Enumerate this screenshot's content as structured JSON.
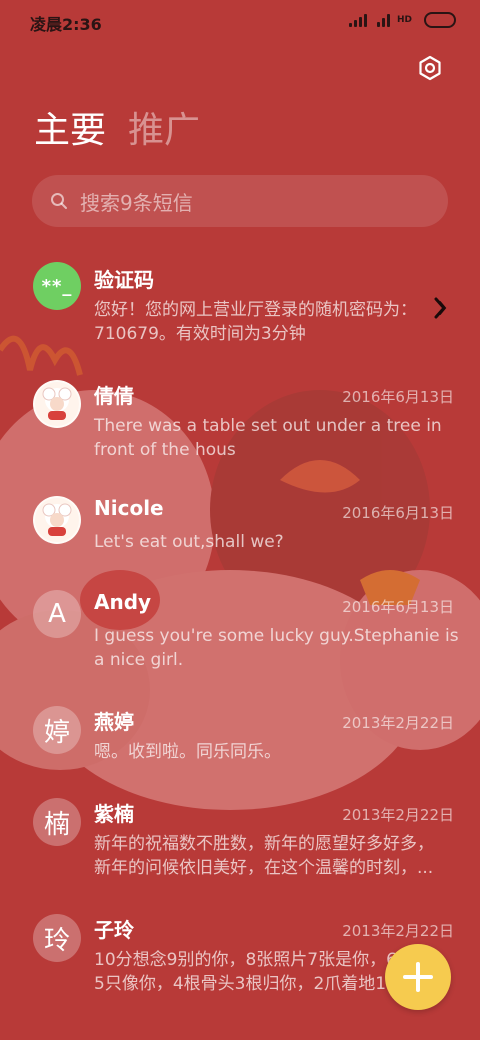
{
  "status_bar": {
    "time": "凌晨2:36",
    "network_label": "HD"
  },
  "tabs": [
    {
      "label": "主要",
      "active": true
    },
    {
      "label": "推广",
      "active": false
    }
  ],
  "search": {
    "placeholder": "搜索9条短信"
  },
  "icons": {
    "settings": "gear-icon",
    "search": "search-icon",
    "compose": "plus-icon",
    "verification_action": "chevron-right-icon"
  },
  "messages": [
    {
      "avatar_type": "badge",
      "avatar_text": "**_",
      "name": "验证码",
      "date": "",
      "preview": "您好！您的网上营业厅登录的随机密码为：710679。有效时间为3分钟"
    },
    {
      "avatar_type": "image",
      "avatar_text": "",
      "name": "倩倩",
      "date": "2016年6月13日",
      "preview": "There was a table set out under a tree in front of the hous"
    },
    {
      "avatar_type": "image",
      "avatar_text": "",
      "name": "Nicole",
      "date": "2016年6月13日",
      "preview": "Let's eat out,shall we?"
    },
    {
      "avatar_type": "letter",
      "avatar_text": "A",
      "name": "Andy",
      "date": "2016年6月13日",
      "preview": "I guess you're some lucky guy.Stephanie is a nice girl."
    },
    {
      "avatar_type": "letter",
      "avatar_text": "婷",
      "name": "燕婷",
      "date": "2013年2月22日",
      "preview": "嗯。收到啦。同乐同乐。"
    },
    {
      "avatar_type": "letter",
      "avatar_text": "楠",
      "name": "紫楠",
      "date": "2013年2月22日",
      "preview_lines": [
        "新年的祝福数不胜数，新年的愿望好多好多，",
        "新年的问候依旧美好，在这个温馨的时刻，..."
      ]
    },
    {
      "avatar_type": "letter",
      "avatar_text": "玲",
      "name": "子玲",
      "date": "2013年2月22日",
      "preview_lines": [
        "10分想念9别的你，8张照片7张是你，6",
        "5只像你，4根骨头3根归你，2爪着地1"
      ]
    }
  ],
  "colors": {
    "background": "#b83a38",
    "accent_fab": "#f6cb4f",
    "verification_badge": "#6fcf62"
  }
}
